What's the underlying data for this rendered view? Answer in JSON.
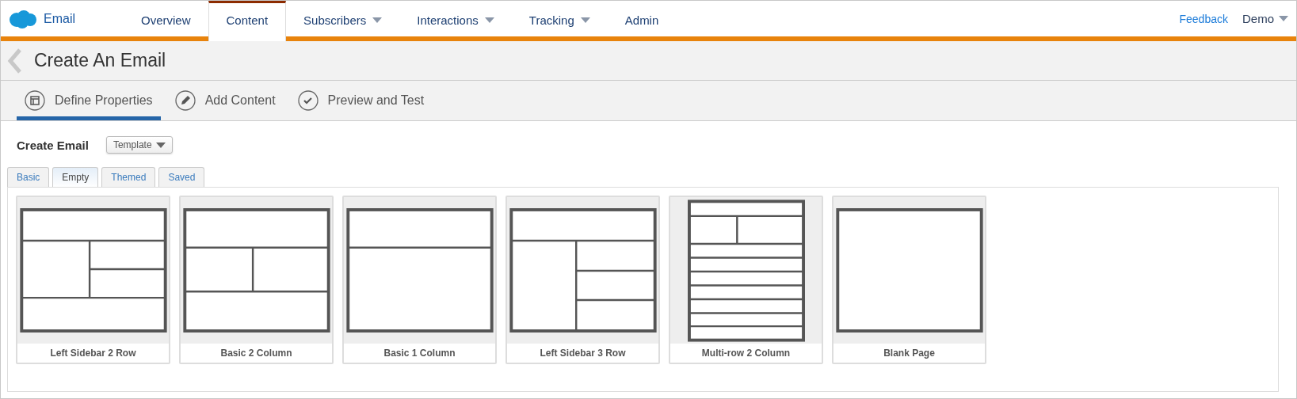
{
  "app": {
    "name": "Email"
  },
  "nav": [
    {
      "label": "Overview",
      "selected": false,
      "dropdown": false
    },
    {
      "label": "Content",
      "selected": true,
      "dropdown": false
    },
    {
      "label": "Subscribers",
      "selected": false,
      "dropdown": true
    },
    {
      "label": "Interactions",
      "selected": false,
      "dropdown": true
    },
    {
      "label": "Tracking",
      "selected": false,
      "dropdown": true
    },
    {
      "label": "Admin",
      "selected": false,
      "dropdown": false
    }
  ],
  "feedback": "Feedback",
  "user": {
    "label": "Demo"
  },
  "page_title": "Create An Email",
  "steps": [
    {
      "label": "Define Properties",
      "kind": "form",
      "selected": true
    },
    {
      "label": "Add Content",
      "kind": "pencil",
      "selected": false
    },
    {
      "label": "Preview and Test",
      "kind": "check",
      "selected": false
    }
  ],
  "section_title": "Create Email",
  "template_button": "Template",
  "tabs": [
    {
      "label": "Basic",
      "selected": false
    },
    {
      "label": "Empty",
      "selected": true
    },
    {
      "label": "Themed",
      "selected": false
    },
    {
      "label": "Saved",
      "selected": false
    }
  ],
  "templates": [
    {
      "name": "Left Sidebar 2 Row",
      "kind": "sidebar2"
    },
    {
      "name": "Basic 2 Column",
      "kind": "columns2"
    },
    {
      "name": "Basic 1 Column",
      "kind": "column1"
    },
    {
      "name": "Left Sidebar 3 Row",
      "kind": "sidebar3"
    },
    {
      "name": "Multi-row 2 Column",
      "kind": "multirow"
    },
    {
      "name": "Blank Page",
      "kind": "blank"
    }
  ]
}
